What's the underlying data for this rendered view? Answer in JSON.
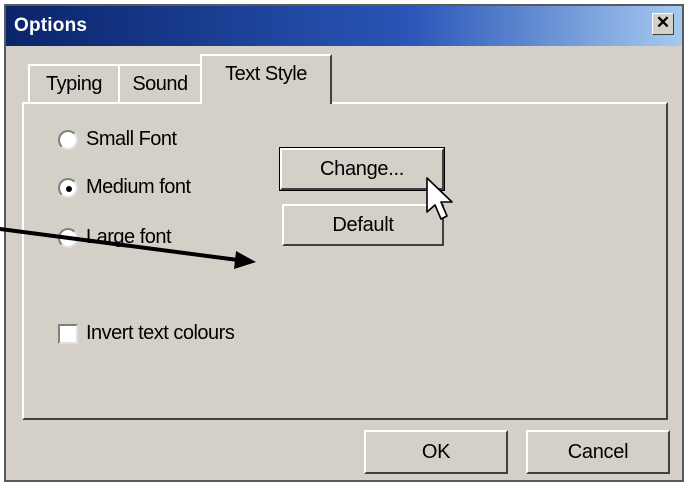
{
  "window": {
    "title": "Options",
    "close_glyph": "✕"
  },
  "tabs": [
    {
      "label": "Typing"
    },
    {
      "label": "Sound"
    },
    {
      "label": "Text Style",
      "selected": true
    }
  ],
  "text_style": {
    "font_options": [
      {
        "label": "Small Font",
        "checked": false
      },
      {
        "label": "Medium font",
        "checked": true
      },
      {
        "label": "Large font",
        "checked": false
      }
    ],
    "change_label": "Change...",
    "default_label": "Default",
    "invert_label": "Invert text colours",
    "invert_checked": false
  },
  "footer": {
    "ok_label": "OK",
    "cancel_label": "Cancel"
  },
  "colors": {
    "titlebar_start": "#0a246a",
    "titlebar_end": "#a6caf0",
    "face": "#d4d0c8"
  },
  "icons": {
    "cursor": "mouse-pointer-icon",
    "annotation": "arrow-icon"
  }
}
